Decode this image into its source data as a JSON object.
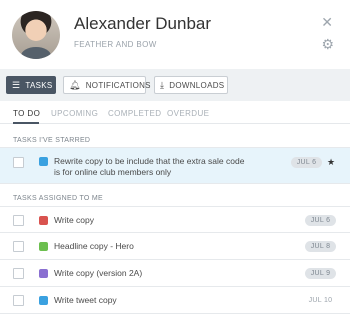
{
  "profile": {
    "name": "Alexander Dunbar",
    "organization": "FEATHER AND BOW"
  },
  "toolbar": {
    "tasks_label": "TASKS",
    "notifications_label": "NOTIFICATIONS",
    "downloads_label": "DOWNLOADS"
  },
  "subtabs": [
    "TO DO",
    "UPCOMING",
    "COMPLETED",
    "OVERDUE"
  ],
  "sections": {
    "starred_title": "TASKS I'VE STARRED",
    "assigned_title": "TASKS ASSIGNED TO ME"
  },
  "starred_tasks": [
    {
      "line1": "Rewrite copy to be include that the extra sale code",
      "line2": "is for online club members only",
      "date": "JUL 6",
      "app_icon": "twitter-icon",
      "color": "#3aa1e0"
    }
  ],
  "assigned_tasks": [
    {
      "text": "Write copy",
      "date": "JUL 6",
      "app_icon": "youtube-icon",
      "color": "#d9534f"
    },
    {
      "text": "Headline copy - Hero",
      "date": "JUL 8",
      "app_icon": "sheet-icon",
      "color": "#6cbf4f"
    },
    {
      "text": "Write copy (version 2A)",
      "date": "JUL 9",
      "app_icon": "tag-icon",
      "color": "#8a6fd1"
    },
    {
      "text": "Write tweet copy",
      "date": "JUL 10",
      "app_icon": "twitter-icon",
      "color": "#3aa1e0"
    }
  ],
  "colors": {
    "accent": "#4a5664",
    "starred_row_bg": "#e7f4fb"
  }
}
